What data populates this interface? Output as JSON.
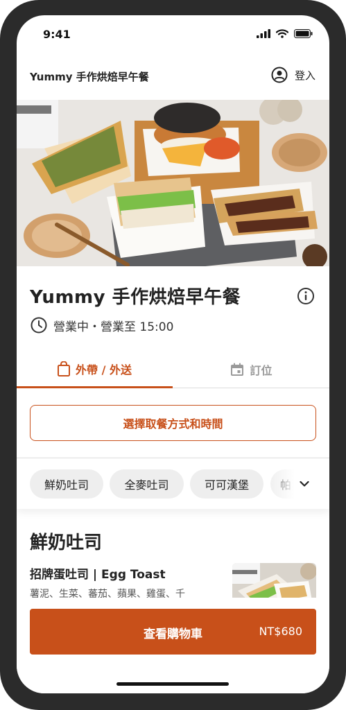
{
  "status": {
    "time": "9:41"
  },
  "header": {
    "title": "Yummy 手作烘焙早午餐",
    "login_label": "登入"
  },
  "store": {
    "name": "Yummy 手作烘焙早午餐",
    "hours": "營業中・營業至 15:00"
  },
  "tabs": [
    {
      "label": "外帶 / 外送",
      "active": true
    },
    {
      "label": "訂位",
      "active": false
    }
  ],
  "choose_button": {
    "label": "選擇取餐方式和時間"
  },
  "categories": [
    {
      "label": "鮮奶吐司"
    },
    {
      "label": "全麥吐司"
    },
    {
      "label": "可可漢堡"
    },
    {
      "label": "帕"
    }
  ],
  "section": {
    "title": "鮮奶吐司",
    "item": {
      "name": "招牌蛋吐司 | Egg Toast",
      "description": "薯泥、生菜、蕃茄、蘋果、雞蛋、千"
    }
  },
  "cart": {
    "label": "查看購物車",
    "total": "NT$680"
  },
  "colors": {
    "accent": "#c8501a",
    "frame": "#2b2b2b"
  }
}
